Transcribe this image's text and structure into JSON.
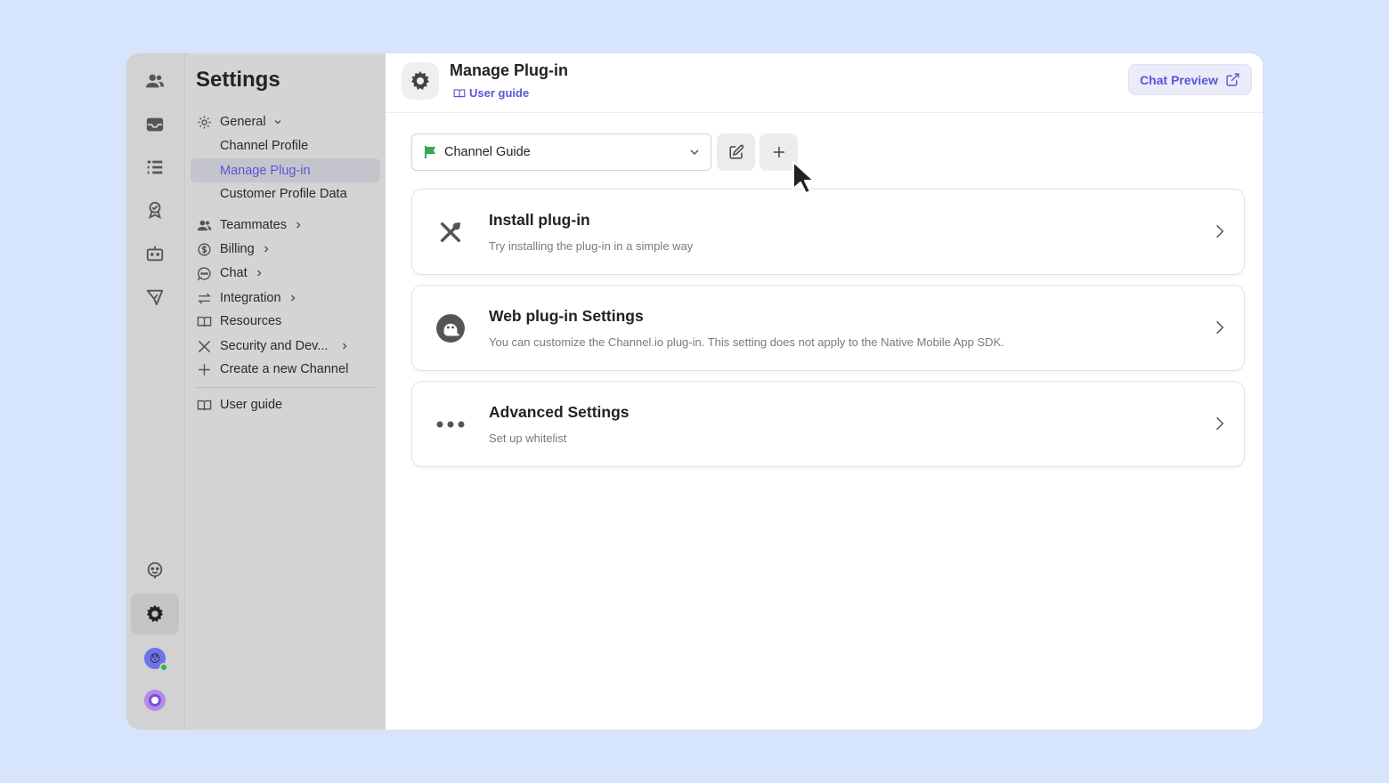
{
  "sidebar": {
    "title": "Settings",
    "general": "General",
    "general_items": [
      "Channel Profile",
      "Manage Plug-in",
      "Customer Profile Data"
    ],
    "teammates": "Teammates",
    "billing": "Billing",
    "chat": "Chat",
    "integration": "Integration",
    "resources": "Resources",
    "security": "Security and Dev...",
    "create_channel": "Create a new Channel",
    "user_guide": "User guide"
  },
  "rail": {
    "icons": [
      "team-icon",
      "inbox-icon",
      "list-icon",
      "badge-icon",
      "bot-icon",
      "send-icon",
      "support-icon",
      "gear-icon",
      "user-avatar",
      "channel-avatar"
    ],
    "active": "gear-icon"
  },
  "header": {
    "title": "Manage Plug-in",
    "guide_link": "User guide",
    "preview_button": "Chat Preview"
  },
  "plugin_select": {
    "value": "Channel Guide",
    "flag_color": "#3aa655"
  },
  "cards": [
    {
      "title": "Install plug-in",
      "desc": "Try installing the plug-in in a simple way",
      "icon": "tools-icon"
    },
    {
      "title": "Web plug-in Settings",
      "desc": "You can customize the Channel.io plug-in. This setting does not apply to the Native Mobile App SDK.",
      "icon": "plugin-face-icon"
    },
    {
      "title": "Advanced Settings",
      "desc": "Set up whitelist",
      "icon": "more-dots-icon"
    }
  ],
  "colors": {
    "accent": "#5a55d8",
    "background": "#d6e4fc",
    "online": "#2fb34a"
  }
}
